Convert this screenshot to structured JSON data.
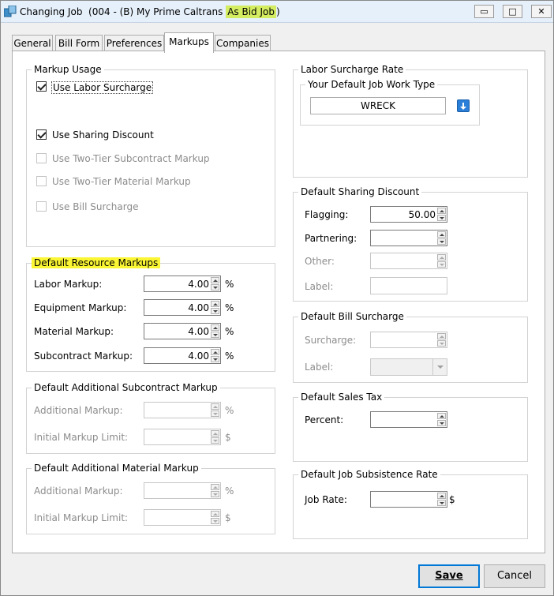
{
  "window": {
    "title_prefix": "Changing Job  (004 - (B) My Prime Caltrans ",
    "title_highlight": "As Bid Job",
    "title_suffix": ")",
    "controls": {
      "minimize": "▭",
      "maximize": "□",
      "close": "✕"
    }
  },
  "tabs": [
    "General",
    "Bill Form",
    "Preferences",
    "Markups",
    "Companies"
  ],
  "active_tab": "Markups",
  "markup_usage": {
    "title": "Markup Usage",
    "items": [
      {
        "label": "Use Labor Surcharge",
        "checked": true,
        "enabled": true
      },
      {
        "label": "Use Sharing Discount",
        "checked": true,
        "enabled": true
      },
      {
        "label": "Use Two-Tier Subcontract Markup",
        "checked": false,
        "enabled": false
      },
      {
        "label": "Use Two-Tier Material Markup",
        "checked": false,
        "enabled": false
      },
      {
        "label": "Use Bill Surcharge",
        "checked": false,
        "enabled": false
      }
    ]
  },
  "resource_markups": {
    "title": "Default Resource Markups",
    "rows": [
      {
        "label": "Labor Markup:",
        "value": "4.00",
        "unit": "%"
      },
      {
        "label": "Equipment Markup:",
        "value": "4.00",
        "unit": "%"
      },
      {
        "label": "Material Markup:",
        "value": "4.00",
        "unit": "%"
      },
      {
        "label": "Subcontract Markup:",
        "value": "4.00",
        "unit": "%"
      }
    ]
  },
  "additional_subcontract": {
    "title": "Default Additional Subcontract Markup",
    "rows": [
      {
        "label": "Additional Markup:",
        "value": "",
        "unit": "%"
      },
      {
        "label": "Initial Markup Limit:",
        "value": "",
        "unit": "$"
      }
    ]
  },
  "additional_material": {
    "title": "Default Additional Material Markup",
    "rows": [
      {
        "label": "Additional Markup:",
        "value": "",
        "unit": "%"
      },
      {
        "label": "Initial Markup Limit:",
        "value": "",
        "unit": "$"
      }
    ]
  },
  "labor_surcharge": {
    "title": "Labor Surcharge Rate",
    "subgroup_title": "Your Default Job Work Type",
    "work_type": "WRECK"
  },
  "sharing_discount": {
    "title": "Default Sharing Discount",
    "rows": [
      {
        "label": "Flagging:",
        "value": "50.00"
      },
      {
        "label": "Partnering:",
        "value": ""
      },
      {
        "label": "Other:",
        "value": ""
      },
      {
        "label": "Label:",
        "value": ""
      }
    ]
  },
  "bill_surcharge": {
    "title": "Default Bill Surcharge",
    "rows": [
      {
        "label": "Surcharge:",
        "value": ""
      },
      {
        "label": "Label:",
        "value": ""
      }
    ]
  },
  "sales_tax": {
    "title": "Default Sales Tax",
    "rows": [
      {
        "label": "Percent:",
        "value": ""
      }
    ]
  },
  "subsistence": {
    "title": "Default Job Subsistence Rate",
    "rows": [
      {
        "label": "Job Rate:",
        "value": "",
        "unit": "$"
      }
    ]
  },
  "buttons": {
    "save": "Save",
    "cancel": "Cancel"
  },
  "colors": {
    "highlight": "#faf633",
    "title_highlight": "#d3ec60",
    "accent": "#0078d7"
  }
}
